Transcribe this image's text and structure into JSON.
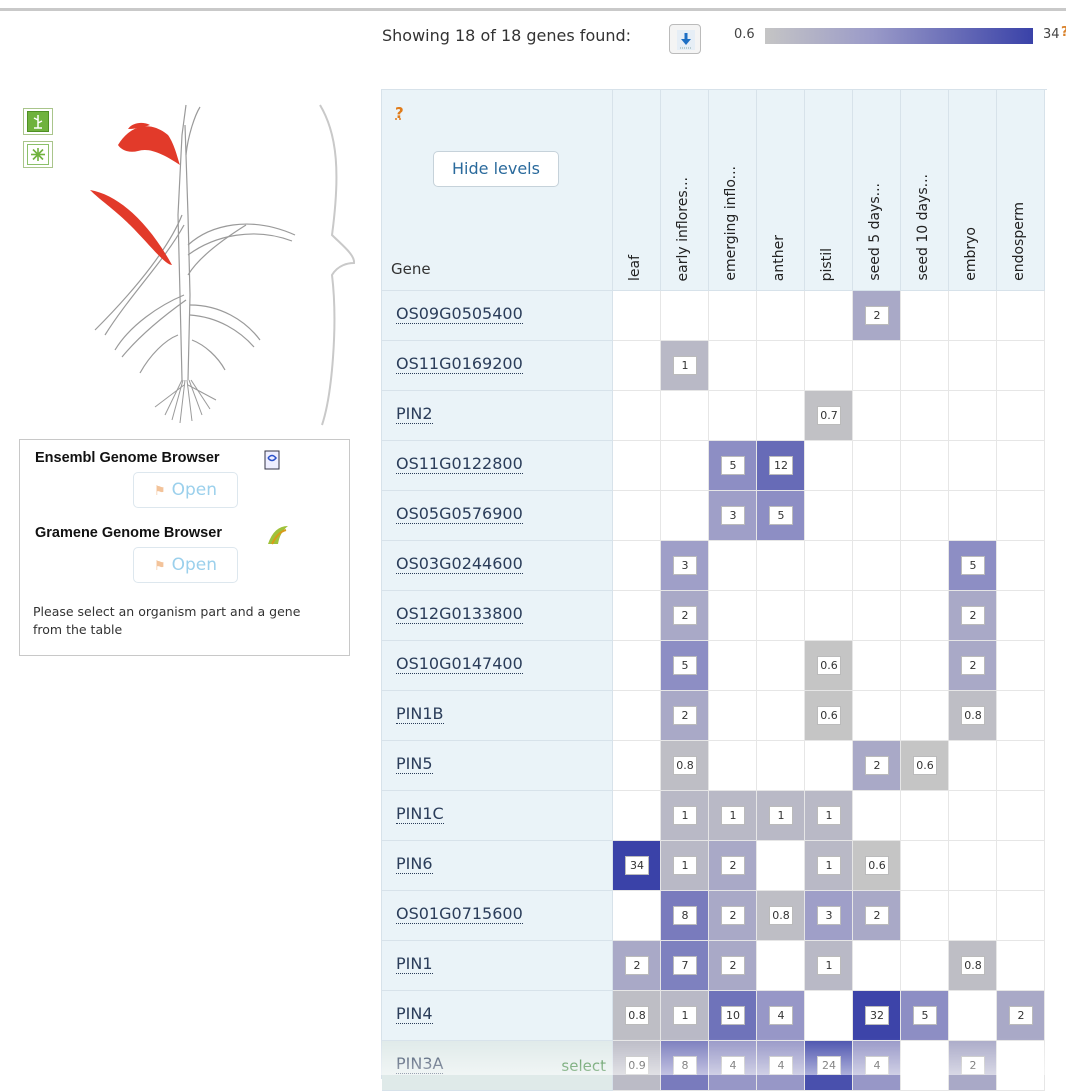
{
  "summary": "Showing 18 of 18 genes found:",
  "legend": {
    "min": "0.6",
    "max": "34",
    "low_color": "#c5c5c5",
    "high_color": "#3a42a8"
  },
  "legend_help": "?",
  "controls": [
    "anatomogram-toggle-icon",
    "flower-icon"
  ],
  "browsers": {
    "ensembl_title": "Ensembl Genome Browser",
    "gramene_title": "Gramene Genome Browser",
    "open_label": "Open",
    "message": "Please select an organism part and a gene from the table"
  },
  "table": {
    "help": "?",
    "hide_levels_label": "Hide levels",
    "gene_header": "Gene",
    "select_label": "select",
    "columns": [
      "leaf",
      "early inflores...",
      "emerging inflo...",
      "anther",
      "pistil",
      "seed 5 days...",
      "seed 10 days...",
      "embryo",
      "endosperm"
    ],
    "rows": [
      {
        "gene": "OS09G0505400",
        "values": [
          null,
          null,
          null,
          null,
          null,
          2,
          null,
          null,
          null
        ]
      },
      {
        "gene": "OS11G0169200",
        "values": [
          null,
          1,
          null,
          null,
          null,
          null,
          null,
          null,
          null
        ]
      },
      {
        "gene": "PIN2",
        "values": [
          null,
          null,
          null,
          null,
          0.7,
          null,
          null,
          null,
          null
        ]
      },
      {
        "gene": "OS11G0122800",
        "values": [
          null,
          null,
          5,
          12,
          null,
          null,
          null,
          null,
          null
        ]
      },
      {
        "gene": "OS05G0576900",
        "values": [
          null,
          null,
          3,
          5,
          null,
          null,
          null,
          null,
          null
        ]
      },
      {
        "gene": "OS03G0244600",
        "values": [
          null,
          3,
          null,
          null,
          null,
          null,
          null,
          5,
          null
        ]
      },
      {
        "gene": "OS12G0133800",
        "values": [
          null,
          2,
          null,
          null,
          null,
          null,
          null,
          2,
          null
        ]
      },
      {
        "gene": "OS10G0147400",
        "values": [
          null,
          5,
          null,
          null,
          0.6,
          null,
          null,
          2,
          null
        ]
      },
      {
        "gene": "PIN1B",
        "values": [
          null,
          2,
          null,
          null,
          0.6,
          null,
          null,
          0.8,
          null
        ]
      },
      {
        "gene": "PIN5",
        "values": [
          null,
          0.8,
          null,
          null,
          null,
          2,
          0.6,
          null,
          null
        ]
      },
      {
        "gene": "PIN1C",
        "values": [
          null,
          1,
          1,
          1,
          1,
          null,
          null,
          null,
          null
        ]
      },
      {
        "gene": "PIN6",
        "values": [
          34,
          1,
          2,
          null,
          1,
          0.6,
          null,
          null,
          null
        ]
      },
      {
        "gene": "OS01G0715600",
        "values": [
          null,
          8,
          2,
          0.8,
          3,
          2,
          null,
          null,
          null
        ]
      },
      {
        "gene": "PIN1",
        "values": [
          2,
          7,
          2,
          null,
          1,
          null,
          null,
          0.8,
          null
        ]
      },
      {
        "gene": "PIN4",
        "values": [
          0.8,
          1,
          10,
          4,
          null,
          32,
          5,
          null,
          2
        ]
      },
      {
        "gene": "PIN3A",
        "values": [
          0.9,
          8,
          4,
          4,
          24,
          4,
          null,
          2,
          null
        ],
        "selected": true
      }
    ]
  }
}
